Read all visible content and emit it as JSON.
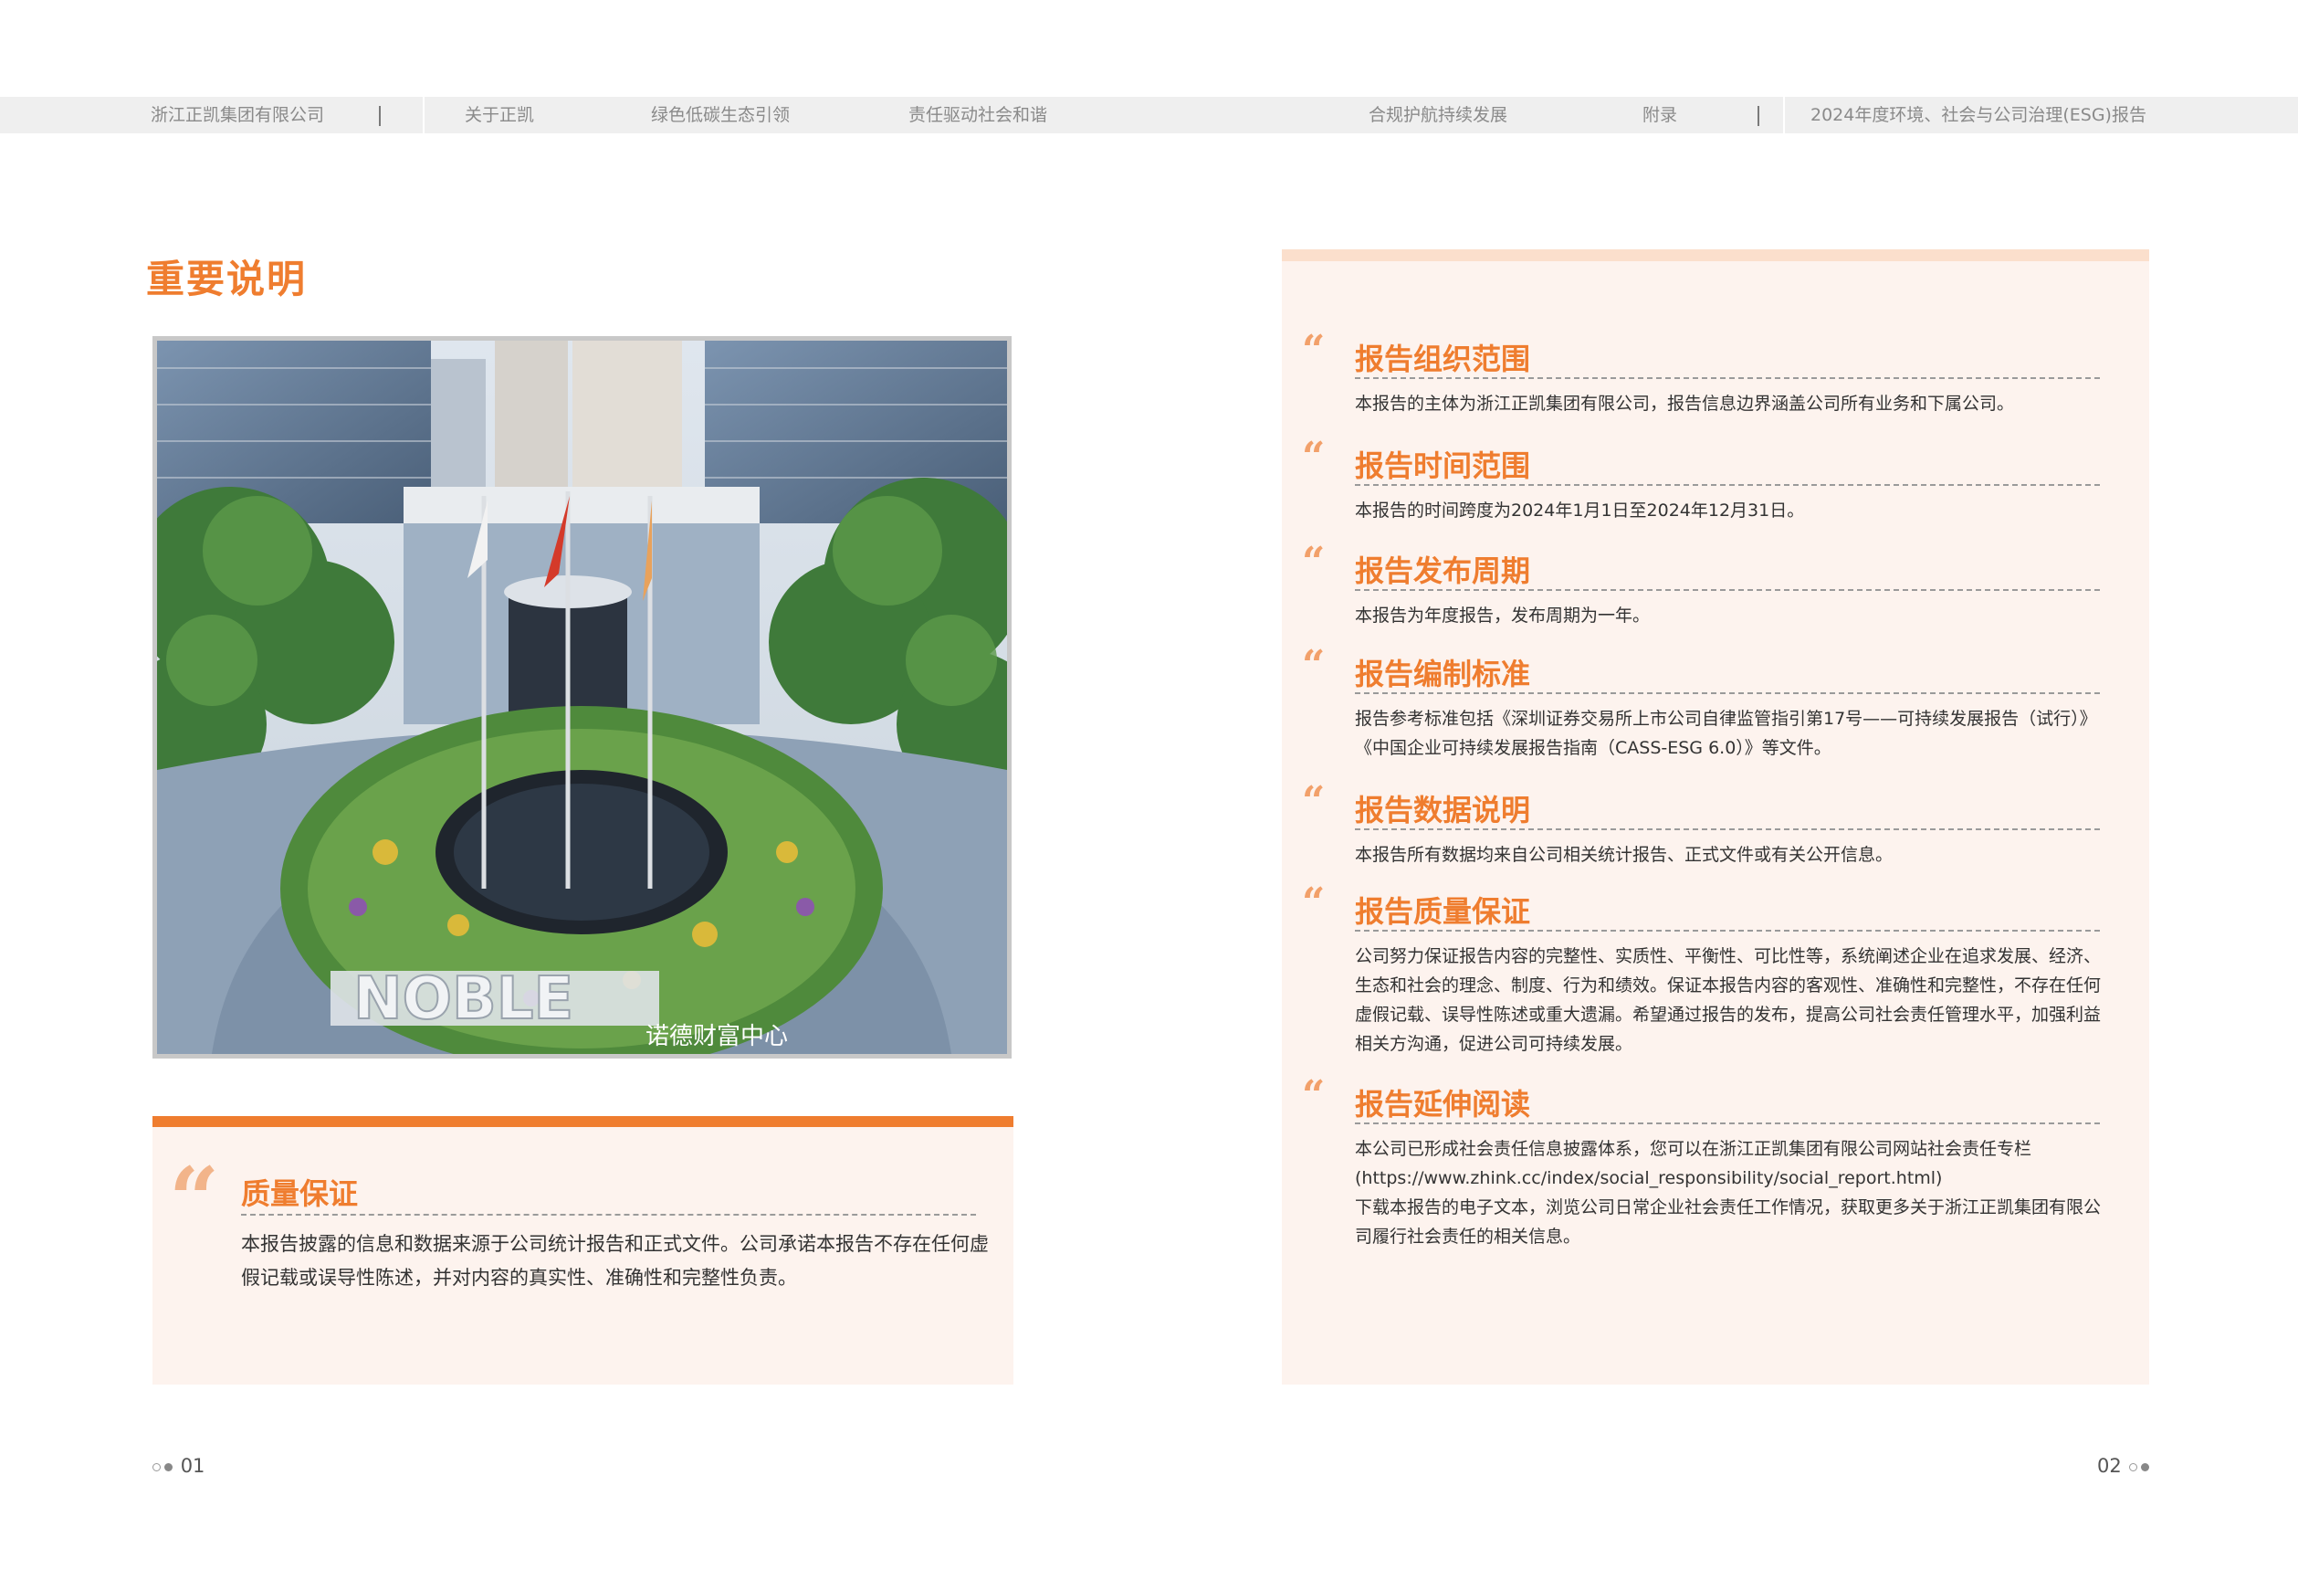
{
  "header": {
    "company": "浙江正凯集团有限公司",
    "nav": [
      "关于正凯",
      "绿色低碳生态引领",
      "责任驱动社会和谐",
      "合规护航持续发展",
      "附录"
    ],
    "report_title": "2024年度环境、社会与公司治理(ESG)报告"
  },
  "page_title": "重要说明",
  "photo": {
    "sign_text": "NOBLE",
    "sign_subtext": "诺德财富中心"
  },
  "quality": {
    "quote_mark": "“",
    "title": "质量保证",
    "body": "本报告披露的信息和数据来源于公司统计报告和正式文件。公司承诺本报告不存在任何虚假记载或误导性陈述，并对内容的真实性、准确性和完整性负责。"
  },
  "sections": [
    {
      "quote_mark": "“",
      "title": "报告组织范围",
      "body": "本报告的主体为浙江正凯集团有限公司，报告信息边界涵盖公司所有业务和下属公司。"
    },
    {
      "quote_mark": "“",
      "title": "报告时间范围",
      "body": "本报告的时间跨度为2024年1月1日至2024年12月31日。"
    },
    {
      "quote_mark": "“",
      "title": "报告发布周期",
      "body": "本报告为年度报告，发布周期为一年。"
    },
    {
      "quote_mark": "“",
      "title": "报告编制标准",
      "body": "报告参考标准包括《深圳证券交易所上市公司自律监管指引第17号——可持续发展报告（试行）》《中国企业可持续发展报告指南（CASS-ESG 6.0）》等文件。"
    },
    {
      "quote_mark": "“",
      "title": "报告数据说明",
      "body": "本报告所有数据均来自公司相关统计报告、正式文件或有关公开信息。"
    },
    {
      "quote_mark": "“",
      "title": "报告质量保证",
      "body": "公司努力保证报告内容的完整性、实质性、平衡性、可比性等，系统阐述企业在追求发展、经济、生态和社会的理念、制度、行为和绩效。保证本报告内容的客观性、准确性和完整性，不存在任何虚假记载、误导性陈述或重大遗漏。希望通过报告的发布，提高公司社会责任管理水平，加强利益相关方沟通，促进公司可持续发展。"
    },
    {
      "quote_mark": "“",
      "title": "报告延伸阅读",
      "body": "本公司已形成社会责任信息披露体系，您可以在浙江正凯集团有限公司网站社会责任专栏\n(https://www.zhink.cc/index/social_responsibility/social_report.html)\n下载本报告的电子文本，浏览公司日常企业社会责任工作情况，获取更多关于浙江正凯集团有限公司履行社会责任的相关信息。"
    }
  ],
  "page_numbers": {
    "left": "01",
    "right": "02"
  },
  "colors": {
    "accent": "#ef7d2f",
    "panel_bg": "#fdf3ee",
    "quote": "#f2a06a"
  }
}
